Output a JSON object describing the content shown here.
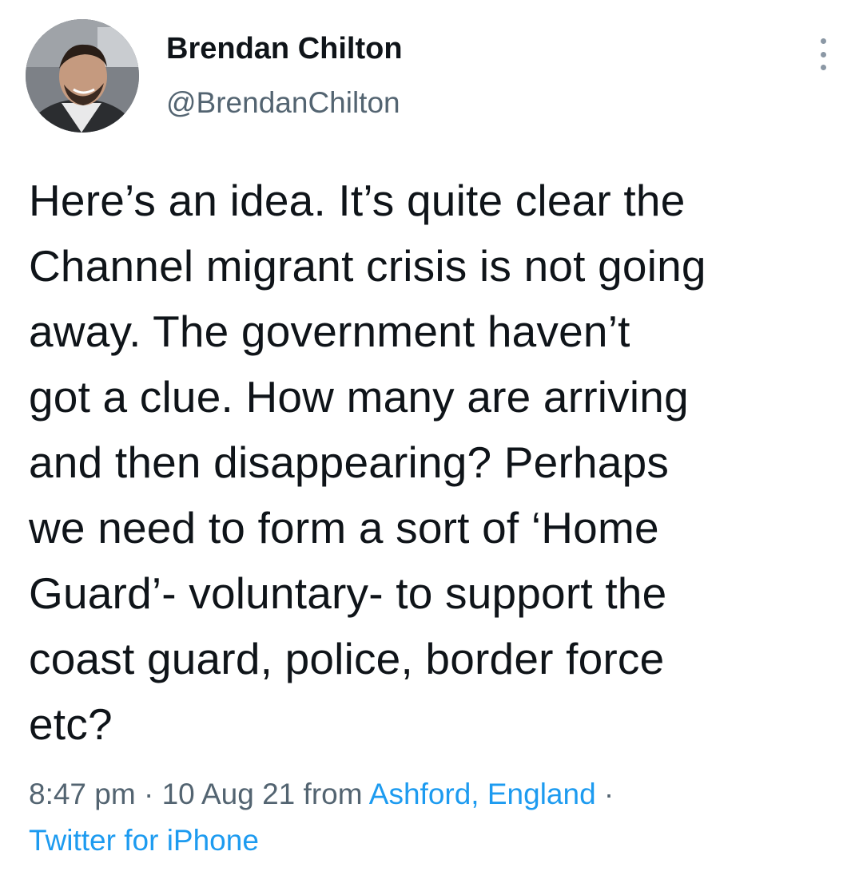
{
  "author": {
    "display_name": "Brendan Chilton",
    "handle": "@BrendanChilton",
    "avatar_icon": "profile-photo"
  },
  "menu_icon": "more-vertical-icon",
  "tweet": {
    "lines": [
      "Here’s an idea. It’s quite clear the",
      "Channel migrant crisis is not going",
      "away. The government haven’t",
      "got a clue. How many are arriving",
      "and then disappearing? Perhaps",
      "we need to form a sort of ‘Home",
      "Guard’- voluntary- to support the",
      "coast guard, police, border force",
      "etc?"
    ]
  },
  "meta": {
    "time": "8:47 pm",
    "separator_1": " · ",
    "date": "10 Aug 21",
    "from_label": " from ",
    "location": "Ashford, England",
    "separator_2": " ·",
    "source": "Twitter for iPhone"
  },
  "colors": {
    "text_primary": "#0f1419",
    "text_secondary": "#536471",
    "link": "#1d9bf0",
    "background": "#ffffff"
  }
}
